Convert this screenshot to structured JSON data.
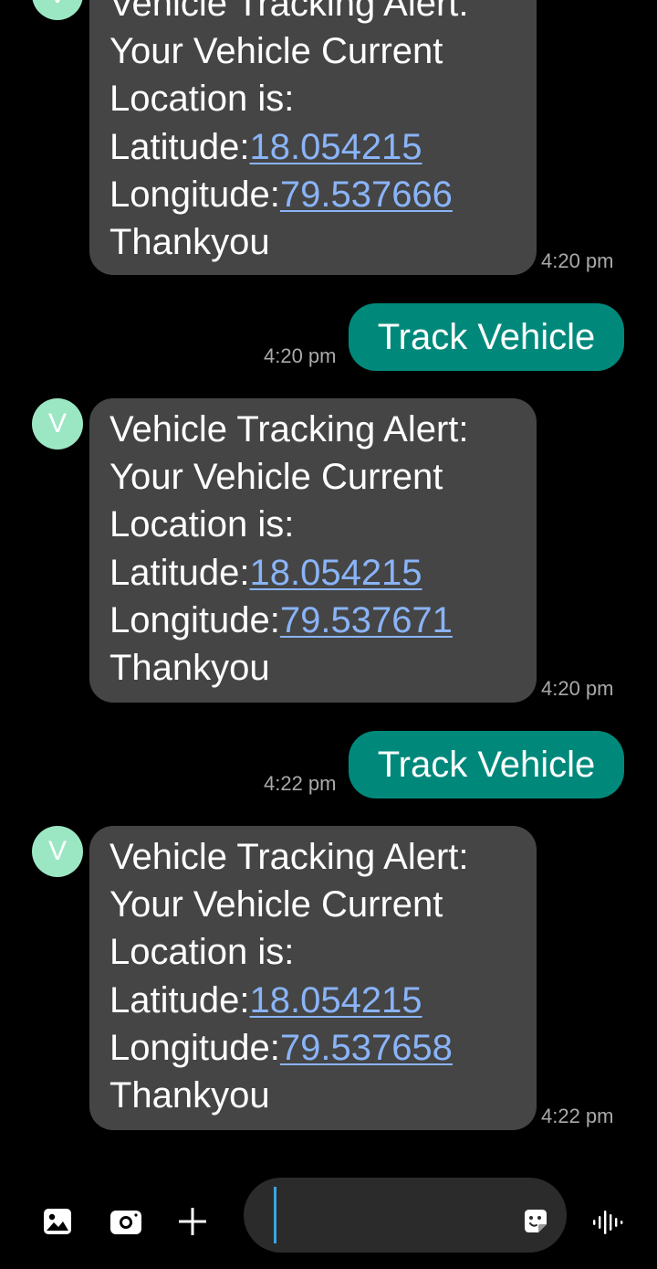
{
  "messages": [
    {
      "type": "incoming",
      "avatar_letter": "V",
      "lines": [
        "Vehicle Tracking Alert:",
        "Your Vehicle Current",
        "Location is:"
      ],
      "latitude_label": "Latitude:",
      "latitude": "18.054215",
      "longitude_label": "Longitude:",
      "longitude": "79.537666",
      "closing": "Thankyou",
      "time": "4:20 pm"
    },
    {
      "type": "outgoing",
      "text": "Track Vehicle",
      "time": "4:20 pm"
    },
    {
      "type": "incoming",
      "avatar_letter": "V",
      "lines": [
        "Vehicle Tracking Alert:",
        "Your Vehicle Current",
        "Location is:"
      ],
      "latitude_label": "Latitude:",
      "latitude": "18.054215",
      "longitude_label": "Longitude:",
      "longitude": "79.537671",
      "closing": "Thankyou",
      "time": "4:20 pm"
    },
    {
      "type": "outgoing",
      "text": "Track Vehicle",
      "time": "4:22 pm"
    },
    {
      "type": "incoming",
      "avatar_letter": "V",
      "lines": [
        "Vehicle Tracking Alert:",
        "Your Vehicle Current",
        "Location is:"
      ],
      "latitude_label": "Latitude:",
      "latitude": "18.054215",
      "longitude_label": "Longitude:",
      "longitude": "79.537658",
      "closing": "Thankyou",
      "time": "4:22 pm"
    }
  ],
  "composer": {
    "input_value": "",
    "icons": [
      "gallery-icon",
      "camera-icon",
      "plus-icon",
      "sticker-icon",
      "voice-icon"
    ]
  },
  "colors": {
    "background": "#000000",
    "incoming_bubble": "#454545",
    "outgoing_bubble": "#00897b",
    "link": "#8ab4f8",
    "avatar": "#9be7c4",
    "caret": "#3aa6e0"
  }
}
